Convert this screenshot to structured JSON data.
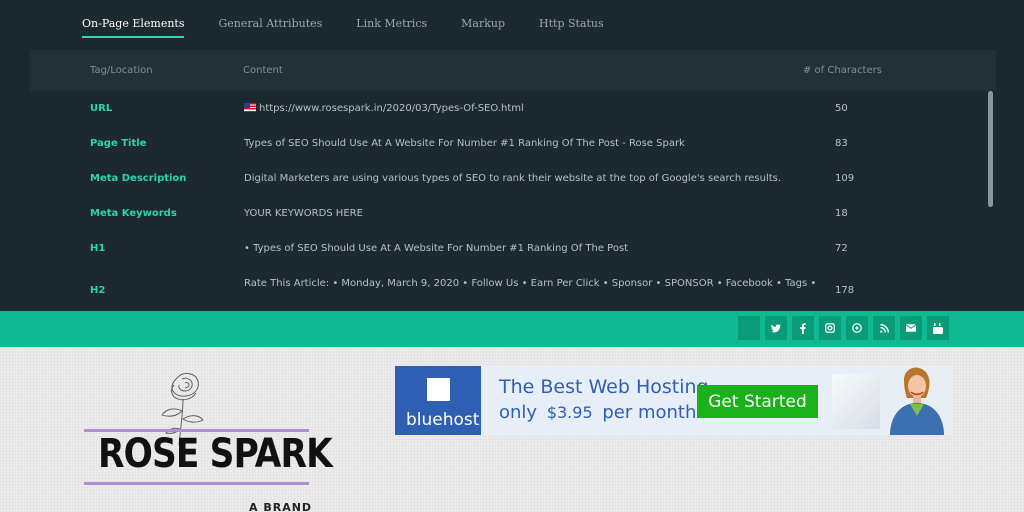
{
  "tabs": [
    {
      "label": "On-Page Elements",
      "active": true
    },
    {
      "label": "General Attributes",
      "active": false
    },
    {
      "label": "Link Metrics",
      "active": false
    },
    {
      "label": "Markup",
      "active": false
    },
    {
      "label": "Http Status",
      "active": false
    }
  ],
  "table": {
    "headers": {
      "tag": "Tag/Location",
      "content": "Content",
      "count": "# of Characters"
    },
    "rows": [
      {
        "tag": "URL",
        "content": "https://www.rosespark.in/2020/03/Types-Of-SEO.html",
        "count": "50"
      },
      {
        "tag": "Page Title",
        "content": "Types of SEO Should Use At A Website For Number #1 Ranking Of The Post - Rose Spark",
        "count": "83"
      },
      {
        "tag": "Meta Description",
        "content": "Digital Marketers are using various types of SEO to rank their website at the top of Google's search results.",
        "count": "109"
      },
      {
        "tag": "Meta Keywords",
        "content": "YOUR KEYWORDS HERE",
        "count": "18"
      },
      {
        "tag": "H1",
        "content": "• Types of SEO Should Use At A Website For Number #1 Ranking Of The Post",
        "count": "72"
      },
      {
        "tag": "H2",
        "content": "Rate This Article: • Monday, March 9, 2020 • Follow Us • Earn Per Click • Sponsor • SPONSOR • Facebook • Tags •",
        "count": "178"
      }
    ]
  },
  "social_icons": [
    "search-icon",
    "twitter-icon",
    "facebook-icon",
    "instagram-icon",
    "pinterest-icon",
    "rss-icon",
    "email-icon",
    "youtube-icon"
  ],
  "site": {
    "logo_text": "ROSE SPARK",
    "logo_sub": "A BRAND"
  },
  "ad": {
    "brand": "bluehost",
    "headline": "The Best Web Hosting",
    "only": "only",
    "price": "$3.95",
    "per": "per month",
    "cta": "Get Started"
  },
  "colors": {
    "panel_bg": "#1c2a30",
    "accent": "#2ad4b1",
    "social_bar": "#0fba93",
    "ad_blue": "#2f5fb3",
    "ad_green": "#1bb11b"
  }
}
